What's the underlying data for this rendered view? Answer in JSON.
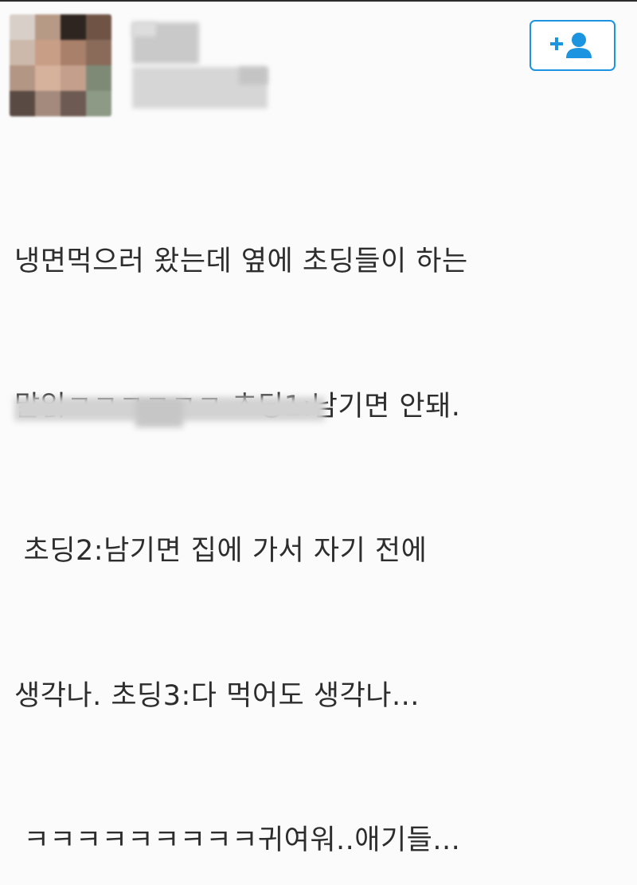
{
  "profile": {
    "avatar_icon": "blurred-profile-photo",
    "display_name": "",
    "handle": ""
  },
  "follow_button": {
    "icon": "add-user-icon",
    "accent_color": "#1c94e0"
  },
  "tweet": {
    "lines": [
      "냉면먹으러 왔는데 옆에 초딩들이 하는",
      "말읽ㅋㅋㅋㅋㅋㅋ 초딩1:남기면 안돼.",
      " 초딩2:남기면 집에 가서 자기 전에",
      "생각나. 초딩3:다 먹어도 생각나...",
      " ㅋㅋㅋㅋㅋㅋㅋㅋㅋ귀여워..애기들..."
    ],
    "text_color": "#2d2d2d"
  },
  "footer": {
    "timestamp": ""
  }
}
